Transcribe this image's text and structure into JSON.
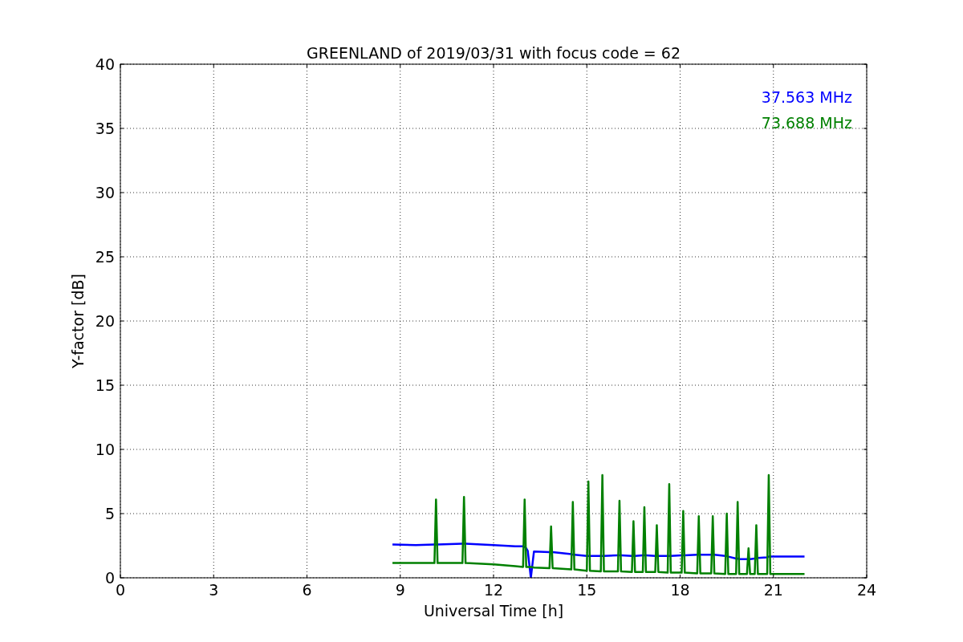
{
  "figure": {
    "chart_data": {
      "type": "line",
      "grid": true,
      "title": "GREENLAND of 2019/03/31 with focus code = 62",
      "xlabel": "Universal Time [h]",
      "ylabel": "Y-factor [dB]",
      "xlim": [
        0,
        24
      ],
      "ylim": [
        0,
        40
      ],
      "xticks": [
        0,
        3,
        6,
        9,
        12,
        15,
        18,
        21,
        24
      ],
      "yticks": [
        0,
        5,
        10,
        15,
        20,
        25,
        30,
        35,
        40
      ],
      "x": [
        8.75,
        9.5,
        10.1,
        10.15,
        10.2,
        11.0,
        11.05,
        11.1,
        12.0,
        12.7,
        12.95,
        13.0,
        13.05,
        13.1,
        13.2,
        13.3,
        13.8,
        13.85,
        13.9,
        14.5,
        14.55,
        14.6,
        15.0,
        15.05,
        15.1,
        15.45,
        15.5,
        15.55,
        16.0,
        16.05,
        16.1,
        16.45,
        16.5,
        16.55,
        16.8,
        16.85,
        16.9,
        17.2,
        17.25,
        17.3,
        17.6,
        17.65,
        17.7,
        18.05,
        18.1,
        18.15,
        18.55,
        18.6,
        18.65,
        19.0,
        19.05,
        19.1,
        19.45,
        19.5,
        19.55,
        19.8,
        19.85,
        19.9,
        20.15,
        20.2,
        20.25,
        20.4,
        20.45,
        20.5,
        20.8,
        20.85,
        20.9,
        22.0
      ],
      "series": [
        {
          "name": "37.563 MHz",
          "color": "#0000ff",
          "values": [
            2.6,
            2.55,
            2.6,
            2.6,
            2.6,
            2.65,
            2.65,
            2.65,
            2.55,
            2.45,
            2.45,
            2.4,
            2.3,
            2.1,
            0,
            2.05,
            2.0,
            2.0,
            2.0,
            1.85,
            1.8,
            1.8,
            1.7,
            1.7,
            1.7,
            1.7,
            1.7,
            1.7,
            1.75,
            1.75,
            1.75,
            1.7,
            1.7,
            1.7,
            1.75,
            1.75,
            1.75,
            1.7,
            1.7,
            1.7,
            1.7,
            1.7,
            1.7,
            1.75,
            1.75,
            1.75,
            1.8,
            1.8,
            1.8,
            1.8,
            1.8,
            1.8,
            1.7,
            1.7,
            1.65,
            1.5,
            1.5,
            1.45,
            1.45,
            1.45,
            1.45,
            1.5,
            1.5,
            1.55,
            1.6,
            1.65,
            1.65,
            1.65
          ]
        },
        {
          "name": "73.688 MHz",
          "color": "#008000",
          "values": [
            1.15,
            1.15,
            1.15,
            6.1,
            1.15,
            1.15,
            6.3,
            1.15,
            1.05,
            0.9,
            0.85,
            6.1,
            0.85,
            0.85,
            0.85,
            0.8,
            0.75,
            4.0,
            0.75,
            0.65,
            5.9,
            0.65,
            0.55,
            7.5,
            0.55,
            0.5,
            8.0,
            0.5,
            0.5,
            6.0,
            0.5,
            0.45,
            4.4,
            0.45,
            0.45,
            5.5,
            0.45,
            0.45,
            4.1,
            0.45,
            0.4,
            7.3,
            0.4,
            0.4,
            5.2,
            0.4,
            0.35,
            4.8,
            0.35,
            0.35,
            4.8,
            0.35,
            0.3,
            5.0,
            0.3,
            0.3,
            5.9,
            0.3,
            0.3,
            2.3,
            0.3,
            0.3,
            4.1,
            0.3,
            0.3,
            8.0,
            0.3,
            0.3
          ]
        }
      ]
    }
  }
}
